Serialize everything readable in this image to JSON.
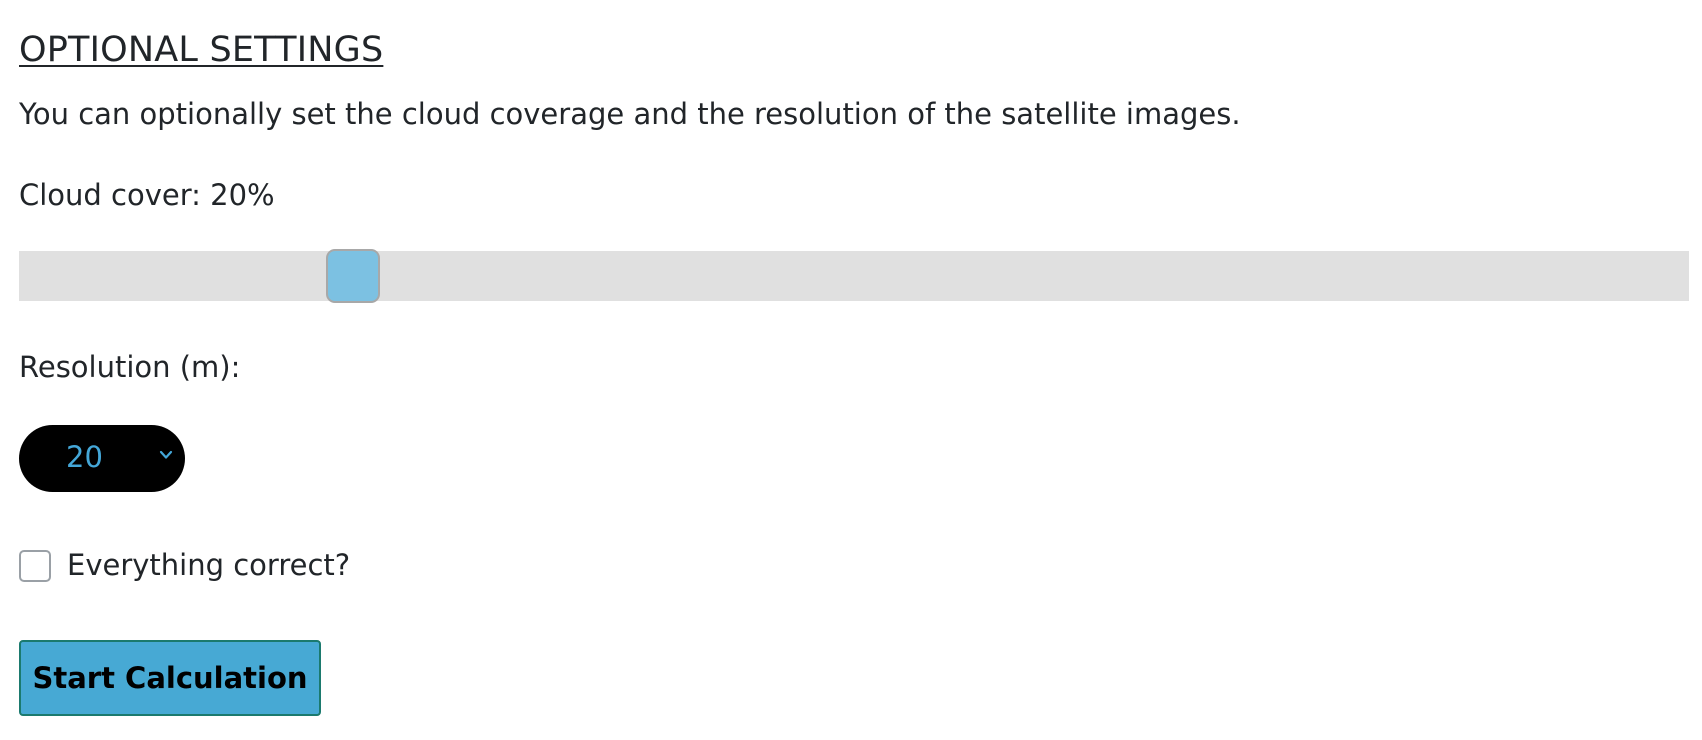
{
  "section": {
    "title": "OPTIONAL SETTINGS",
    "description": "You can optionally set the cloud coverage and the resolution of the satellite images."
  },
  "cloud_cover": {
    "label": "Cloud cover: 20%",
    "value_percent": 20
  },
  "resolution": {
    "label": "Resolution (m):",
    "selected": "20"
  },
  "confirm": {
    "label": "Everything correct?",
    "checked": false
  },
  "actions": {
    "start_label": "Start Calculation"
  },
  "colors": {
    "slider_track": "#e0e0e0",
    "slider_thumb": "#7cc1e2",
    "select_background": "#000000",
    "select_text": "#44a7d8",
    "button_background": "#47a9d4",
    "button_border": "#1b7a6e"
  },
  "icons": {
    "select_arrow": "chevron-down-icon"
  }
}
